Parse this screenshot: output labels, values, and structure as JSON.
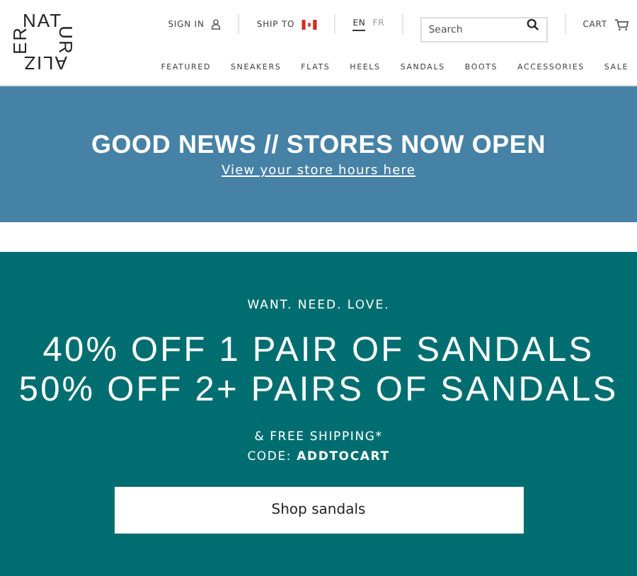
{
  "logo": {
    "top": "NAT",
    "right": "UR",
    "bottom": "ALIZ",
    "left": "ER"
  },
  "utility": {
    "sign_in": "SIGN IN",
    "ship_to": "SHIP TO",
    "languages": [
      {
        "label": "EN",
        "selected": true
      },
      {
        "label": "FR",
        "selected": false
      }
    ],
    "search": {
      "placeholder": "Search"
    },
    "cart": "CART"
  },
  "nav": [
    "FEATURED",
    "SNEAKERS",
    "FLATS",
    "HEELS",
    "SANDALS",
    "BOOTS",
    "ACCESSORIES",
    "SALE"
  ],
  "banner": {
    "title": "GOOD NEWS // STORES NOW OPEN",
    "link": "View your store hours here"
  },
  "promo": {
    "eyebrow": "WANT. NEED. LOVE.",
    "headlines": [
      "40% OFF 1 PAIR OF SANDALS",
      "50% OFF 2+ PAIRS OF SANDALS"
    ],
    "shipping": "& FREE SHIPPING*",
    "code": "CODE: **ADDTOCART**",
    "button": "Shop sandals"
  }
}
